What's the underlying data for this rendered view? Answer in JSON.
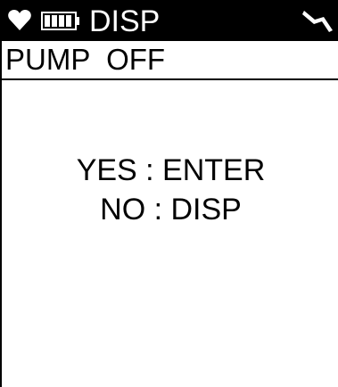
{
  "status_bar": {
    "mode_title": "DISP",
    "icons": [
      "heart-icon",
      "battery-icon",
      "pump-icon"
    ]
  },
  "pump_status": {
    "label": "PUMP  OFF"
  },
  "prompt": {
    "yes_line": "YES : ENTER",
    "no_line": "NO : DISP"
  },
  "colors": {
    "background": "#ffffff",
    "status_bar": "#000000",
    "text": "#000000"
  }
}
